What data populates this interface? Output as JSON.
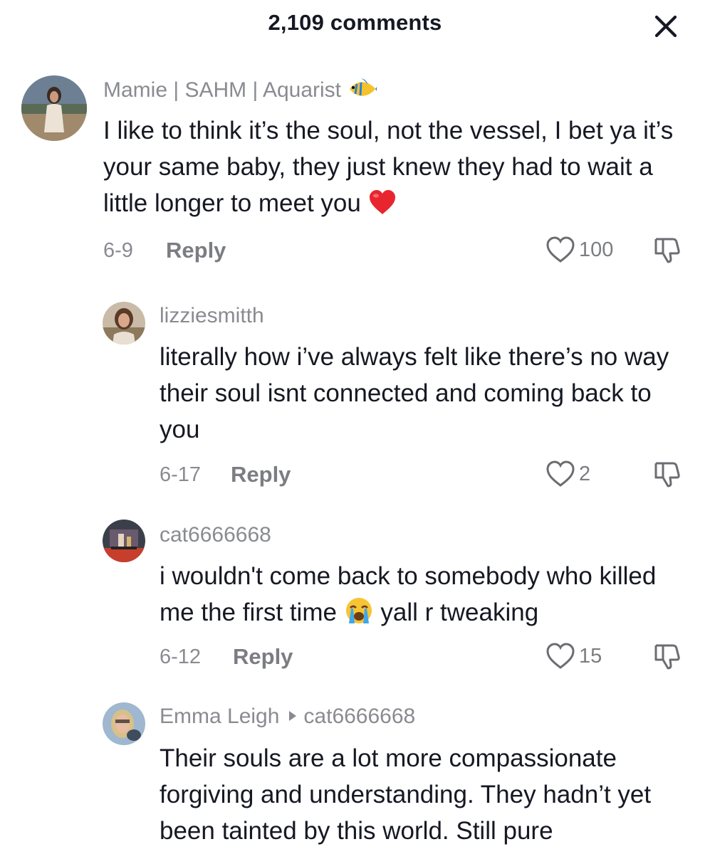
{
  "header": {
    "title": "2,109 comments",
    "close_icon": "close-icon"
  },
  "colors": {
    "text": "#161823",
    "secondary": "#8a8b91",
    "heart_red": "#e8252e"
  },
  "comments": [
    {
      "username": "Mamie | SAHM | Aquarist",
      "username_emoji": "tropical-fish-icon",
      "text": "I like to think it’s the soul, not the vessel, I bet ya it’s your same baby, they just knew they had to wait a little longer to meet you",
      "text_emoji": "red-heart-icon",
      "date": "6-9",
      "reply_label": "Reply",
      "likes": "100"
    },
    {
      "username": "lizziesmitth",
      "text": "literally how i’ve always felt like there’s no way their soul isnt connected and coming back to you",
      "date": "6-17",
      "reply_label": "Reply",
      "likes": "2"
    },
    {
      "username": "cat6666668",
      "text_part1": "i wouldn't come back to somebody who killed me the first time",
      "text_emoji": "loudly-crying-face-icon",
      "text_part2": "yall r tweaking",
      "date": "6-12",
      "reply_label": "Reply",
      "likes": "15"
    },
    {
      "username": "Emma Leigh",
      "reply_to": "cat6666668",
      "text": "Their souls are a lot more compassionate forgiving and understanding. They hadn’t yet been tainted by this world. Still pure"
    }
  ]
}
